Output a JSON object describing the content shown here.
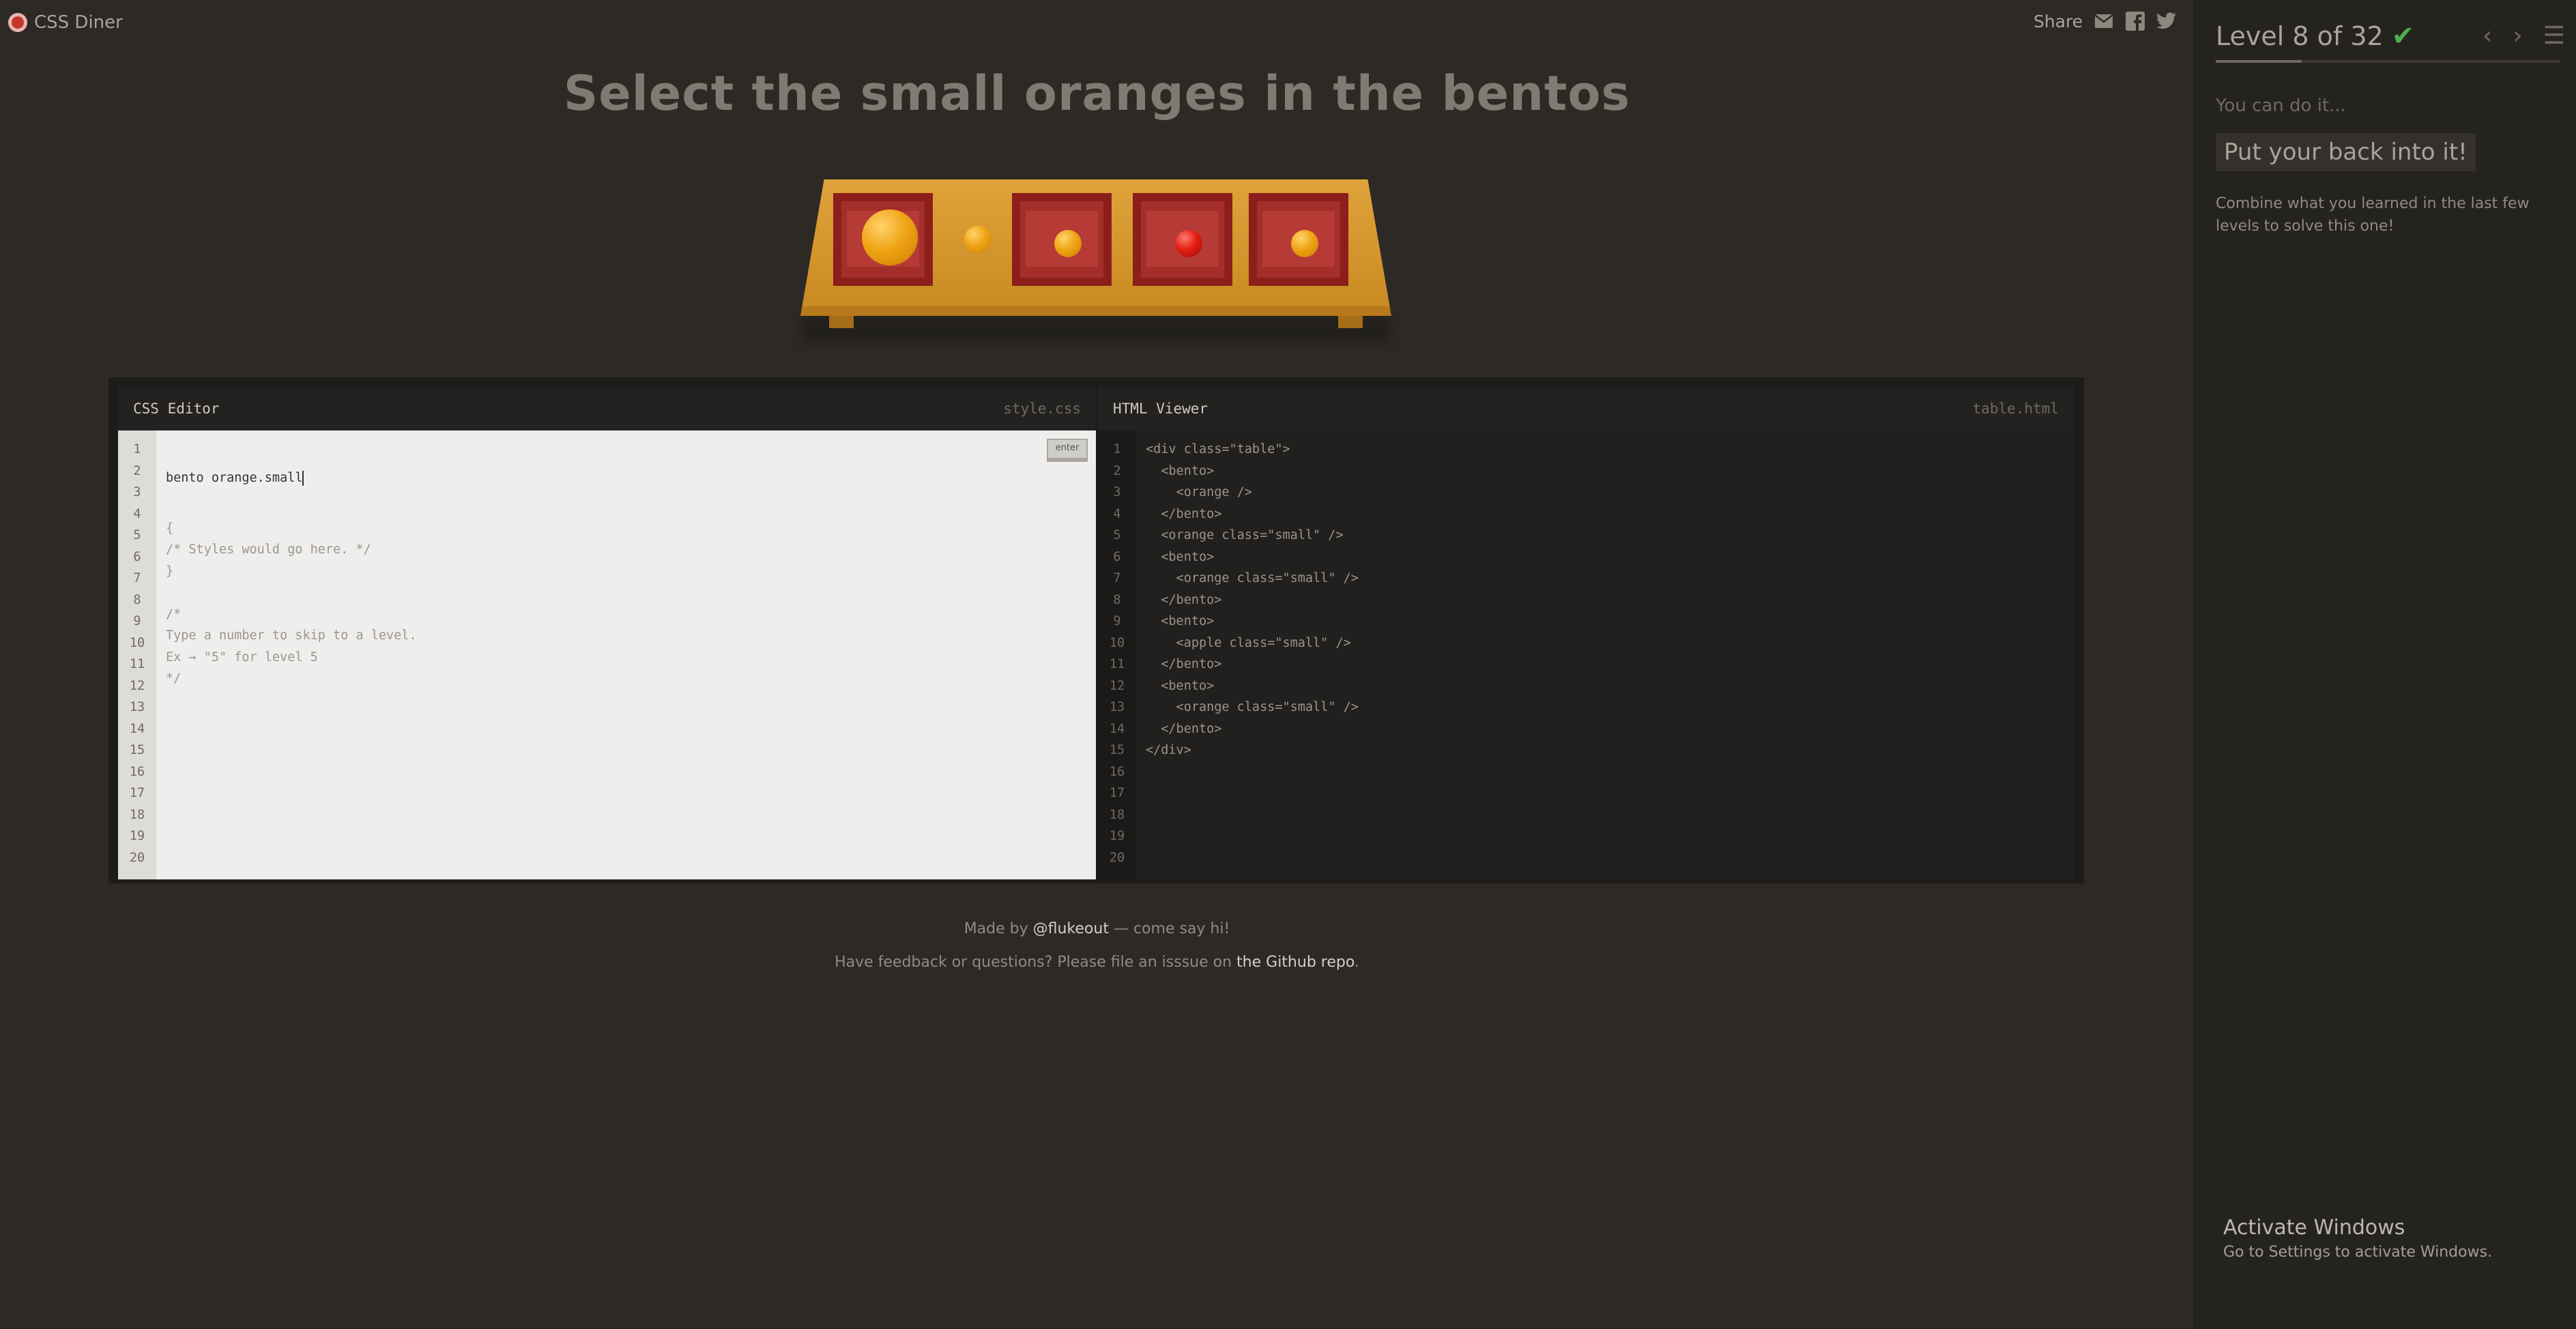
{
  "app": {
    "name": "CSS Diner"
  },
  "share": {
    "label": "Share",
    "icons": [
      "email-icon",
      "facebook-icon",
      "twitter-icon"
    ]
  },
  "order": "Select the small oranges in the bentos",
  "table": {
    "items": [
      {
        "container": "bento",
        "item": "orange"
      },
      {
        "container": "none",
        "item": "orange small"
      },
      {
        "container": "bento",
        "item": "orange small"
      },
      {
        "container": "bento",
        "item": "apple small"
      },
      {
        "container": "bento",
        "item": "orange small"
      }
    ]
  },
  "css_editor": {
    "title": "CSS Editor",
    "file": "style.css",
    "enter_label": "enter",
    "input_value": "bento orange.small",
    "lines": [
      "",
      "{",
      "/* Styles would go here. */",
      "}",
      "",
      "/*",
      "Type a number to skip to a level.",
      "Ex → \"5\" for level 5",
      "*/",
      "",
      "",
      "",
      "",
      "",
      "",
      "",
      "",
      "",
      "",
      ""
    ],
    "line_numbers": [
      "1",
      "2",
      "3",
      "4",
      "5",
      "6",
      "7",
      "8",
      "9",
      "10",
      "11",
      "12",
      "13",
      "14",
      "15",
      "16",
      "17",
      "18",
      "19",
      "20"
    ]
  },
  "html_viewer": {
    "title": "HTML Viewer",
    "file": "table.html",
    "lines": [
      "<div class=\"table\">",
      "  <bento>",
      "    <orange />",
      "  </bento>",
      "  <orange class=\"small\" />",
      "  <bento>",
      "    <orange class=\"small\" />",
      "  </bento>",
      "  <bento>",
      "    <apple class=\"small\" />",
      "  </bento>",
      "  <bento>",
      "    <orange class=\"small\" />",
      "  </bento>",
      "</div>",
      "",
      "",
      "",
      "",
      ""
    ],
    "line_numbers": [
      "1",
      "2",
      "3",
      "4",
      "5",
      "6",
      "7",
      "8",
      "9",
      "10",
      "11",
      "12",
      "13",
      "14",
      "15",
      "16",
      "17",
      "18",
      "19",
      "20"
    ]
  },
  "footer": {
    "made_by_prefix": "Made by ",
    "made_by_link": "@flukeout",
    "made_by_suffix": " — come say hi!",
    "feedback_prefix": "Have feedback or questions? Please file an isssue on ",
    "feedback_link": "the Github repo",
    "feedback_suffix": "."
  },
  "sidebar": {
    "level_title": "Level 8 of 32",
    "completed": true,
    "progress": 0.25,
    "hint_intro": "You can do it...",
    "hint_box": "Put your back into it!",
    "hint_desc": "Combine what you learned in the last few levels to solve this one!"
  },
  "watermark": {
    "title": "Activate Windows",
    "subtitle": "Go to Settings to activate Windows."
  },
  "colors": {
    "background": "#2d2a26",
    "sidebar": "#252320",
    "check": "#4cae4c",
    "orange": "#f0a516",
    "apple": "#e41e14",
    "bento": "#a32e2a",
    "table": "#e0a23a"
  }
}
